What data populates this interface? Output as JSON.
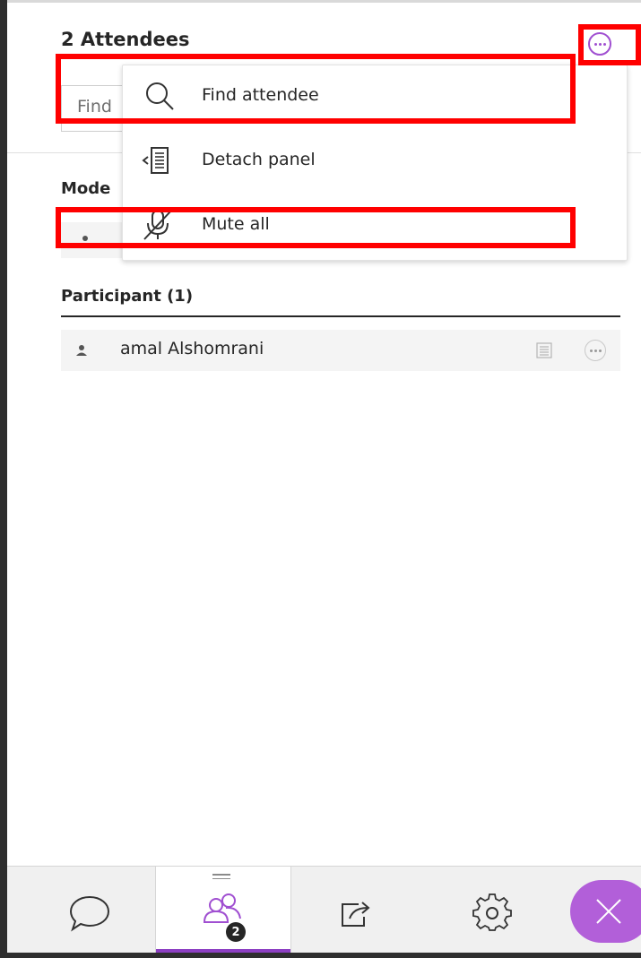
{
  "header": {
    "title": "2 Attendees"
  },
  "search": {
    "placeholder_fragment": "Find"
  },
  "moderators": {
    "header_fragment": "Mode"
  },
  "menu": {
    "items": [
      {
        "label": "Find attendee",
        "icon": "search-icon"
      },
      {
        "label": "Detach panel",
        "icon": "detach-panel-icon"
      },
      {
        "label": "Mute all",
        "icon": "mic-off-icon"
      }
    ]
  },
  "participants": {
    "header": "Participant (1)",
    "rows": [
      {
        "name": "amal Alshomrani"
      }
    ]
  },
  "tabbar": {
    "tabs": [
      {
        "name": "chat",
        "icon": "chat-bubble-icon"
      },
      {
        "name": "attendees",
        "icon": "attendees-icon",
        "badge": "2",
        "active": true
      },
      {
        "name": "share",
        "icon": "share-icon"
      },
      {
        "name": "settings",
        "icon": "gear-icon"
      },
      {
        "name": "close",
        "icon": "close-icon"
      }
    ]
  },
  "colors": {
    "accent": "#8c3fc2",
    "highlight": "#ff0000",
    "close_button": "#b25fd9"
  }
}
